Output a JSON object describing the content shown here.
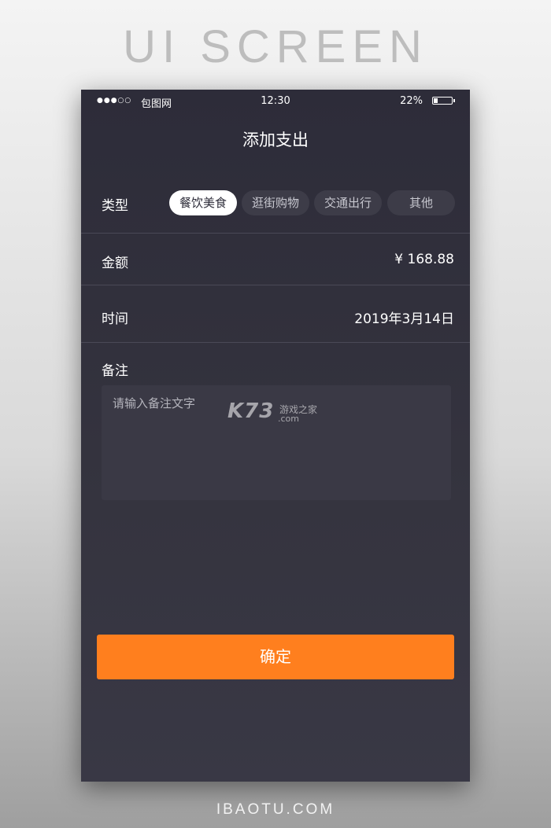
{
  "banner": {
    "title": "UI SCREEN"
  },
  "status_bar": {
    "signal": "●●●○○",
    "carrier": "包图网",
    "time": "12:30",
    "battery_percent": "22%",
    "battery_level": 0.22
  },
  "header": {
    "title": "添加支出"
  },
  "type_row": {
    "label": "类型",
    "options": [
      "餐饮美食",
      "逛街购物",
      "交通出行",
      "其他"
    ],
    "selected": "餐饮美食"
  },
  "amount_row": {
    "label": "金额",
    "value": "¥ 168.88"
  },
  "time_row": {
    "label": "时间",
    "value": "2019年3月14日"
  },
  "note": {
    "label": "备注",
    "placeholder": "请输入备注文字"
  },
  "watermark": {
    "logo": "K73",
    "name": "游戏之家",
    "domain": ".com"
  },
  "confirm": {
    "label": "确定"
  },
  "colors": {
    "accent": "#ff7f1e",
    "background": "#2d2c39",
    "chip_inactive": "#3d3c48",
    "chip_active": "#ffffff"
  },
  "footer": {
    "brand": "IBAOTU.COM"
  }
}
